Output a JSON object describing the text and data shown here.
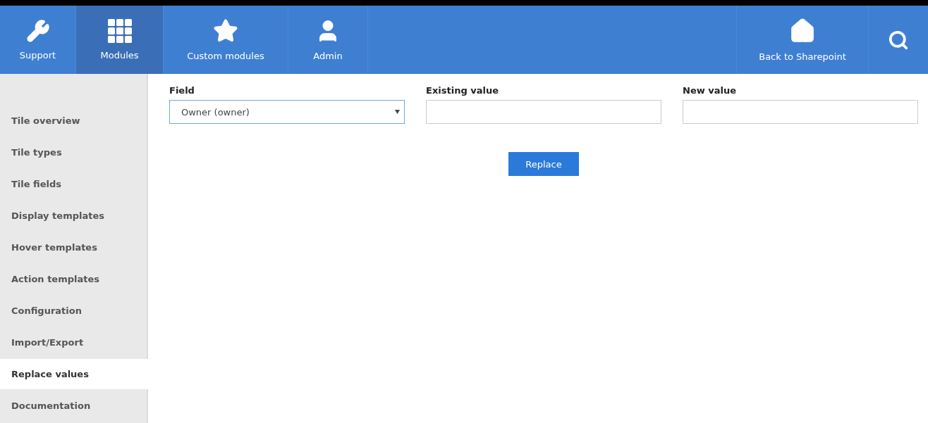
{
  "nav": {
    "items": [
      {
        "label": "Support",
        "selected": false
      },
      {
        "label": "Modules",
        "selected": true
      },
      {
        "label": "Custom modules",
        "selected": false
      },
      {
        "label": "Admin",
        "selected": false
      }
    ],
    "right_items": [
      {
        "label": "Back to Sharepoint",
        "selected": false
      }
    ]
  },
  "sidebar": {
    "items": [
      {
        "label": "Tile overview",
        "selected": false
      },
      {
        "label": "Tile types",
        "selected": false
      },
      {
        "label": "Tile fields",
        "selected": false
      },
      {
        "label": "Display templates",
        "selected": false
      },
      {
        "label": "Hover templates",
        "selected": false
      },
      {
        "label": "Action templates",
        "selected": false
      },
      {
        "label": "Configuration",
        "selected": false
      },
      {
        "label": "Import/Export",
        "selected": false
      },
      {
        "label": "Replace values",
        "selected": true
      },
      {
        "label": "Documentation",
        "selected": false
      }
    ]
  },
  "form": {
    "fields": [
      {
        "kind": "select",
        "label": "Field",
        "value": "Owner (owner)"
      },
      {
        "kind": "text",
        "label": "Existing value"
      },
      {
        "kind": "text",
        "label": "New value"
      }
    ],
    "button": "Replace"
  }
}
